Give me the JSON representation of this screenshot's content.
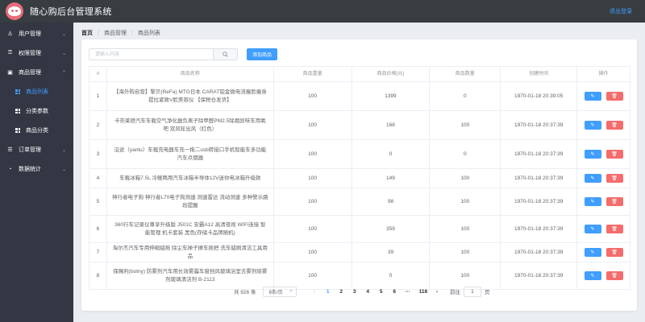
{
  "header": {
    "title": "随心购后台管理系统",
    "logout": "退出登录"
  },
  "sidebar": {
    "items": [
      {
        "label": "用户管理",
        "icon": "user-icon",
        "glyph": "♙"
      },
      {
        "label": "权限管理",
        "icon": "lock-icon",
        "glyph": "⚿"
      },
      {
        "label": "商品管理",
        "icon": "shopping-bag-icon",
        "glyph": "▣",
        "children": [
          {
            "label": "商品列表",
            "active": true
          },
          {
            "label": "分类参数"
          },
          {
            "label": "商品分类"
          }
        ]
      },
      {
        "label": "订单管理",
        "icon": "list-icon",
        "glyph": "☰"
      },
      {
        "label": "数据统计",
        "icon": "chart-icon",
        "glyph": "◔"
      }
    ]
  },
  "breadcrumb": {
    "home": "首页",
    "level1": "商品管理",
    "level2": "商品列表",
    "sep": "/"
  },
  "toolbar": {
    "search_placeholder": "请输入内容",
    "add_label": "添加商品"
  },
  "table": {
    "headers": [
      "#",
      "商品名称",
      "商品重量",
      "商品价格(元)",
      "商品数量",
      "创建时间",
      "操作"
    ],
    "rows": [
      {
        "idx": "1",
        "name": "【海外购自营】黎贝(ReFa) MTG日本 CARAT铂金微电流瘦脸瘦身提拉紧致V脸美容仪 【保税仓发货】",
        "weight": "100",
        "price": "1399",
        "qty": "0",
        "time": "1970-01-18 20:39:05",
        "h": 36
      },
      {
        "idx": "2",
        "name": "卡奈莱德汽车车载空气净化器负离子除甲醛PM2.5除烟异味车用氧吧 双风轮出风（红色）",
        "weight": "100",
        "price": "168",
        "qty": "100",
        "time": "1970-01-18 20:37:39",
        "h": 36
      },
      {
        "idx": "3",
        "name": "沿途（yantu）车载充电器车充一拖二usb转接口手机智能车多功能汽车点烟器",
        "weight": "100",
        "price": "0",
        "qty": "0",
        "time": "1970-01-18 20:37:39",
        "h": 36
      },
      {
        "idx": "4",
        "name": "车载冰箱7.5L 冷暖两用汽车冰箱半导体12V迷你电冰箱升级款",
        "weight": "100",
        "price": "149",
        "qty": "100",
        "time": "1970-01-18 20:37:39",
        "h": 24
      },
      {
        "idx": "5",
        "name": "神行者电子狗 神行者L70电子狗测速 测速雷达 流动测速 多种警示路段提醒",
        "weight": "100",
        "price": "98",
        "qty": "100",
        "time": "1970-01-18 20:37:39",
        "h": 34
      },
      {
        "idx": "6",
        "name": "360行车记录仪尊享升级版 J501C 安霸A12 高清夜视 WIFI连接 智能管理 机卡套装 黑色(存储卡品牌随机)",
        "weight": "100",
        "price": "359",
        "qty": "100",
        "time": "1970-01-18 20:37:39",
        "h": 34
      },
      {
        "idx": "7",
        "name": "淘尔杰汽车专用伸缩蜡拖 除尘车掸子擦车拖把 洗车蜡刷清洁工具用品",
        "weight": "100",
        "price": "39",
        "qty": "100",
        "time": "1970-01-18 20:37:39",
        "h": 24
      },
      {
        "idx": "8",
        "name": "保赐利(botny) 防雾剂汽车用长效雾霾车窗挡风玻璃浴室去雾剂除雾剂玻璃清洁剂 B-2113",
        "weight": "100",
        "price": "0",
        "qty": "100",
        "time": "1970-01-18 20:37:39",
        "h": 34
      }
    ]
  },
  "pagination": {
    "total": "共 926 条",
    "page_size": "8条/页",
    "pages": [
      "1",
      "2",
      "3",
      "4",
      "5",
      "6"
    ],
    "active_page": "1",
    "ellipsis": "···",
    "last_page": "116",
    "goto_label": "前往",
    "goto_value": "1",
    "page_unit": "页"
  },
  "colors": {
    "primary": "#409eff",
    "danger": "#f56c6c",
    "header_bg": "#373d41",
    "sidebar_bg": "#333744"
  }
}
